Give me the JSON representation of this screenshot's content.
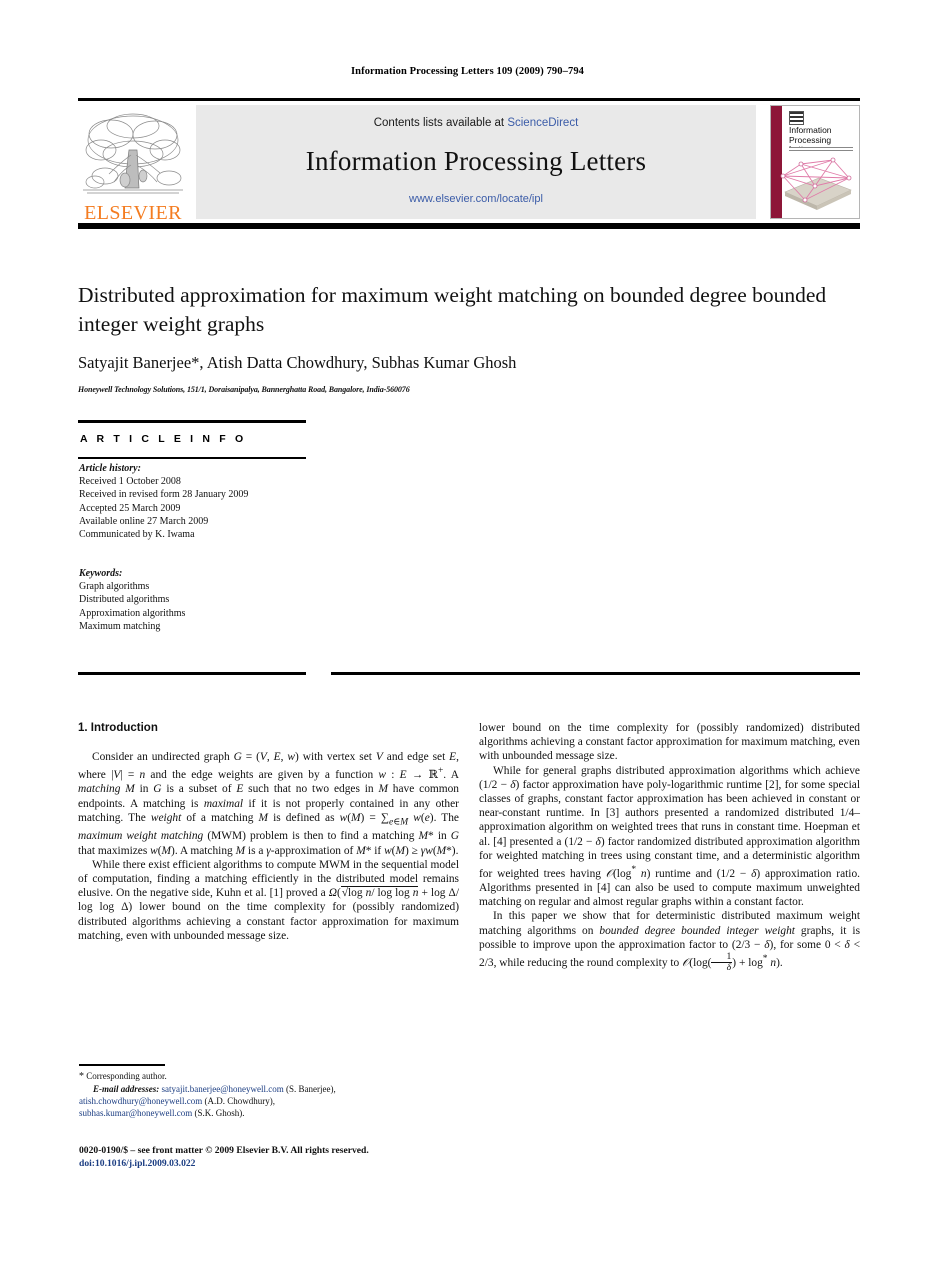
{
  "running_head": "Information Processing Letters 109 (2009) 790–794",
  "masthead": {
    "publisher_name": "ELSEVIER",
    "contents_prefix": "Contents lists available at ",
    "contents_link": "ScienceDirect",
    "journal_name": "Information Processing Letters",
    "journal_url": "www.elsevier.com/locate/ipl",
    "cover_title": "Information Processing Letters",
    "colors": {
      "link": "#3b5ca8",
      "elsevier_orange": "#F47C20",
      "panel_bg": "#e9e9e9",
      "cover_spine": "#8d1638"
    }
  },
  "article": {
    "title": "Distributed approximation for maximum weight matching on bounded degree bounded integer weight graphs",
    "authors": "Satyajit Banerjee*, Atish Datta Chowdhury, Subhas Kumar Ghosh",
    "affiliation": "Honeywell Technology Solutions, 151/1, Doraisanipalya, Bannerghatta Road, Bangalore, India-560076"
  },
  "info": {
    "heading": "A R T I C L E    I N F O",
    "history_label": "Article history:",
    "history": [
      "Received 1 October 2008",
      "Received in revised form 28 January 2009",
      "Accepted 25 March 2009",
      "Available online 27 March 2009",
      "Communicated by K. Iwama"
    ],
    "keywords_label": "Keywords:",
    "keywords": [
      "Graph algorithms",
      "Distributed algorithms",
      "Approximation algorithms",
      "Maximum matching"
    ]
  },
  "body": {
    "section_number_title": "1. Introduction",
    "left_p1_a": "Consider an undirected graph ",
    "left_p1_b": " with vertex set ",
    "left_p1_c": " and edge set ",
    "left_p1_d": ", where ",
    "left_p1_e": " and the edge weights are given by a function ",
    "left_p1_f": ". A ",
    "left_p1_matching": "matching",
    "left_p1_g": " in ",
    "left_p1_h": " is a subset of ",
    "left_p1_i": " such that no two edges in ",
    "left_p1_j": " have common endpoints. A matching is ",
    "left_p1_maximal": "maximal",
    "left_p1_k": " if it is not properly contained in any other matching. The ",
    "left_p1_weight": "weight",
    "left_p1_l": " of a matching ",
    "left_p1_m": " is defined as ",
    "left_p1_n": ". The ",
    "left_p1_mwm_it": "maximum weight matching",
    "left_p1_o": " (MWM) problem is then to find a matching ",
    "left_p1_p": " in ",
    "left_p1_q": " that maximizes ",
    "left_p1_r": ". A matching ",
    "left_p1_s": " is a ",
    "left_p1_t": "-approximation of ",
    "left_p1_u": " if ",
    "left_p2_a": "While there exist efficient algorithms to compute MWM in the sequential model of computation, finding a matching efficiently in the distributed model remains elusive. On the negative side, Kuhn et al. [1] proved a ",
    "left_p2_b": " lower bound on the time complexity for (possibly randomized) distributed algorithms achieving a constant factor approximation for maximum matching, even with unbounded message size.",
    "right_p1_a": "While for general graphs distributed approximation algorithms which achieve ",
    "right_p1_b": " factor approximation have poly-logarithmic runtime [2], for some special classes of graphs, constant factor approximation has been achieved in constant or near-constant runtime. In [3] authors presented a randomized distributed 1/4–approximation algorithm on weighted trees that runs in constant time. Hoepman et al. [4] presented a ",
    "right_p1_c": " factor randomized distributed approximation algorithm for weighted matching in trees using constant time, and a deterministic algorithm for weighted trees having ",
    "right_p1_d": " runtime and ",
    "right_p1_e": " approximation ratio. Algorithms presented in [4] can also be used to compute maximum unweighted matching on regular and almost regular graphs within a constant factor.",
    "right_p2_a": "In this paper we show that for deterministic distributed maximum weight matching algorithms on ",
    "right_p2_it1": "bounded degree bounded integer weight",
    "right_p2_b": " graphs, it is possible to improve upon the approximation factor to ",
    "right_p2_c": ", for some ",
    "right_p2_d": ", while reducing the round complexity to ",
    "right_p2_e": "."
  },
  "footnote": {
    "star": "*",
    "corresponding": "Corresponding author.",
    "email_label": "E-mail addresses:",
    "emails": [
      {
        "address": "satyajit.banerjee@honeywell.com",
        "name": "(S. Banerjee),"
      },
      {
        "address": "atish.chowdhury@honeywell.com",
        "name": "(A.D. Chowdhury),"
      },
      {
        "address": "subhas.kumar@honeywell.com",
        "name": "(S.K. Ghosh)."
      }
    ]
  },
  "colophon": {
    "line1": "0020-0190/$ – see front matter © 2009 Elsevier B.V. All rights reserved.",
    "doi": "doi:10.1016/j.ipl.2009.03.022"
  }
}
